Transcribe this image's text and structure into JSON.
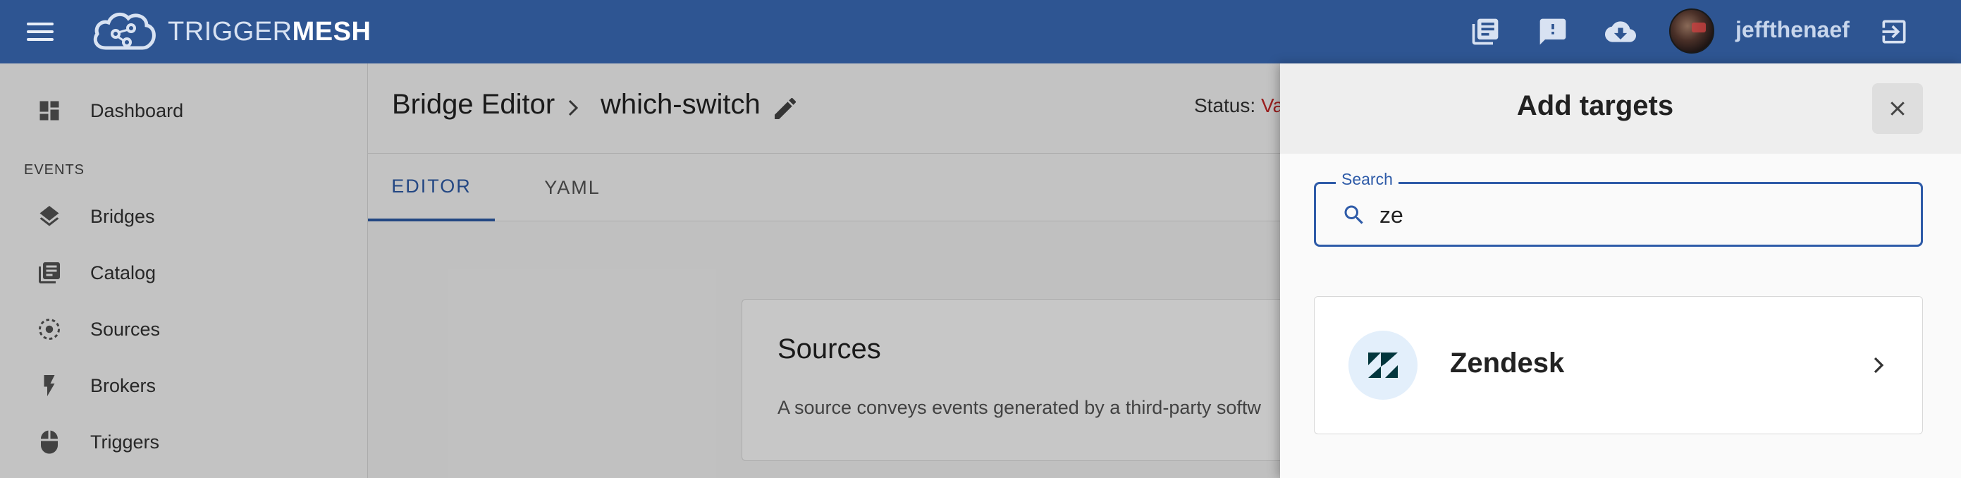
{
  "app": {
    "logo_prefix": "TRIGGER",
    "logo_suffix": "MESH",
    "username": "jeffthenaef"
  },
  "topbar_icons": [
    "docs-icon",
    "feedback-icon",
    "cloud-download-icon",
    "logout-icon"
  ],
  "sidebar": {
    "items": [
      {
        "label": "Dashboard",
        "icon": "dashboard-icon"
      },
      {
        "label": "Bridges",
        "icon": "layers-icon"
      },
      {
        "label": "Catalog",
        "icon": "library-icon"
      },
      {
        "label": "Sources",
        "icon": "source-icon"
      },
      {
        "label": "Brokers",
        "icon": "bolt-icon"
      },
      {
        "label": "Triggers",
        "icon": "mouse-icon"
      }
    ],
    "section_events": "EVENTS"
  },
  "editor": {
    "breadcrumb_root": "Bridge Editor",
    "bridge_name": "which-switch",
    "status_label": "Status:",
    "status_value": "Va",
    "tabs": [
      {
        "label": "EDITOR",
        "active": true
      },
      {
        "label": "YAML",
        "active": false
      }
    ],
    "sources_card": {
      "title": "Sources",
      "description": "A source conveys events generated by a third-party softw"
    }
  },
  "drawer": {
    "title": "Add targets",
    "search_label": "Search",
    "search_value": "ze",
    "results": [
      {
        "name": "Zendesk",
        "icon": "zendesk-icon"
      }
    ]
  },
  "colors": {
    "topbar": "#2e5592",
    "accent": "#2e5ba8",
    "status_invalid": "#c62828"
  }
}
